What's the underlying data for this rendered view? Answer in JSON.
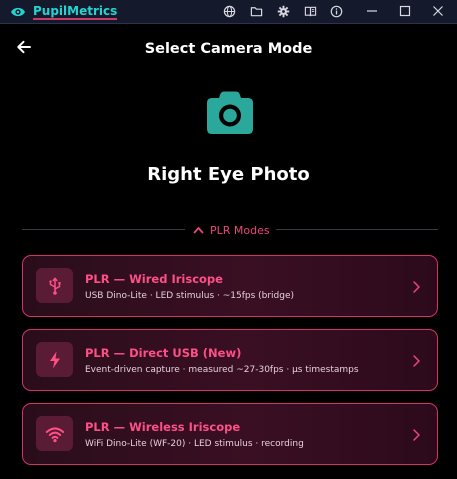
{
  "titlebar": {
    "app_name": "PupilMetrics",
    "icons": [
      "globe-icon",
      "folder-icon",
      "gear-icon",
      "book-icon",
      "info-icon"
    ],
    "window_controls": [
      "minimize-icon",
      "maximize-icon",
      "close-icon"
    ]
  },
  "header": {
    "title": "Select Camera Mode"
  },
  "hero": {
    "icon": "camera-icon",
    "title": "Right Eye Photo"
  },
  "section": {
    "label": "PLR Modes"
  },
  "modes": [
    {
      "title": "PLR — Wired Iriscope",
      "subtitle": "USB Dino-Lite · LED stimulus · ~15fps (bridge)",
      "icon": "usb-icon"
    },
    {
      "title": "PLR — Direct USB (New)",
      "subtitle": "Event-driven capture · measured ~27-30fps · µs timestamps",
      "icon": "lightning-icon"
    },
    {
      "title": "PLR — Wireless Iriscope",
      "subtitle": "WiFi Dino-Lite (WF-20) · LED stimulus · recording",
      "icon": "wifi-icon"
    }
  ],
  "colors": {
    "accent": "#e8477a",
    "brand": "#27d3d0",
    "camera": "#2aa89c",
    "card_border": "#d4336a",
    "titlebar_bg": "#141a2c"
  }
}
